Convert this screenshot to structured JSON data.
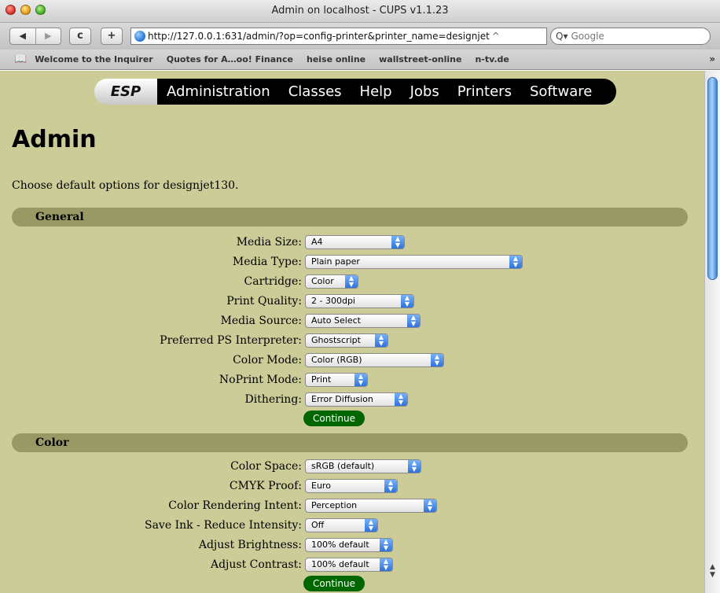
{
  "window": {
    "title": "Admin on localhost - CUPS v1.1.23"
  },
  "toolbar": {
    "back": "◀",
    "forward": "▶",
    "reload": "c",
    "add": "+",
    "url": "http://127.0.0.1:631/admin/?op=config-printer&printer_name=designjet",
    "url_end": "^",
    "search_placeholder": "Google",
    "search_icon": "Q▾"
  },
  "bookmarks": {
    "book_icon": "📖",
    "items": [
      "Welcome to the Inquirer",
      "Quotes for A…oo! Finance",
      "heise online",
      "wallstreet-online",
      "n-tv.de"
    ],
    "more": "»"
  },
  "nav": {
    "logo": "ESP",
    "items": [
      "Administration",
      "Classes",
      "Help",
      "Jobs",
      "Printers",
      "Software"
    ]
  },
  "page": {
    "title": "Admin",
    "intro": "Choose default options for designjet130."
  },
  "general": {
    "heading": "General",
    "options": [
      {
        "label": "Media Size:",
        "value": "A4"
      },
      {
        "label": "Media Type:",
        "value": "Plain paper"
      },
      {
        "label": "Cartridge:",
        "value": "Color"
      },
      {
        "label": "Print Quality:",
        "value": "2 - 300dpi"
      },
      {
        "label": "Media Source:",
        "value": "Auto Select"
      },
      {
        "label": "Preferred PS Interpreter:",
        "value": "Ghostscript"
      },
      {
        "label": "Color Mode:",
        "value": "Color (RGB)"
      },
      {
        "label": "NoPrint Mode:",
        "value": "Print"
      },
      {
        "label": "Dithering:",
        "value": "Error Diffusion"
      }
    ],
    "continue": "Continue"
  },
  "color": {
    "heading": "Color",
    "options": [
      {
        "label": "Color Space:",
        "value": "sRGB (default)"
      },
      {
        "label": "CMYK Proof:",
        "value": "Euro"
      },
      {
        "label": "Color Rendering Intent:",
        "value": "Perception"
      },
      {
        "label": "Save Ink - Reduce Intensity:",
        "value": "Off"
      },
      {
        "label": "Adjust Brightness:",
        "value": "100% default"
      },
      {
        "label": "Adjust Contrast:",
        "value": "100% default"
      }
    ],
    "continue": "Continue"
  },
  "colors": {
    "content_bg": "#cccc99",
    "section_bg": "#999966",
    "button_green": "#006600"
  }
}
